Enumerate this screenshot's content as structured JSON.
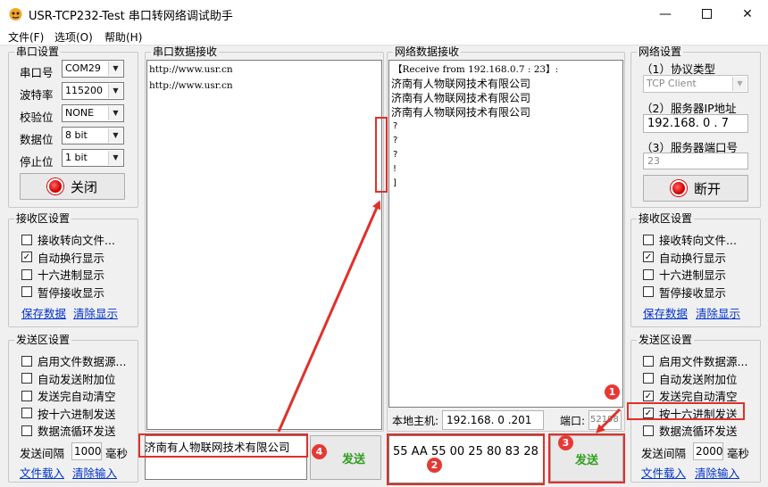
{
  "window": {
    "title": "USR-TCP232-Test 串口转网络调试助手"
  },
  "menu": {
    "file": "文件(F)",
    "options": "选项(O)",
    "help": "帮助(H)"
  },
  "serial_settings": {
    "title": "串口设置",
    "port_label": "串口号",
    "port": "COM29",
    "baud_label": "波特率",
    "baud": "115200",
    "parity_label": "校验位",
    "parity": "NONE",
    "databits_label": "数据位",
    "databits": "8 bit",
    "stopbits_label": "停止位",
    "stopbits": "1 bit",
    "close_button": "关闭"
  },
  "serial_recv_settings": {
    "title": "接收区设置",
    "options": [
      {
        "label": "接收转向文件...",
        "checked": false
      },
      {
        "label": "自动换行显示",
        "checked": true
      },
      {
        "label": "十六进制显示",
        "checked": false
      },
      {
        "label": "暂停接收显示",
        "checked": false
      }
    ],
    "save_link": "保存数据",
    "clear_link": "清除显示"
  },
  "serial_send_settings": {
    "title": "发送区设置",
    "options": [
      {
        "label": "启用文件数据源...",
        "checked": false
      },
      {
        "label": "自动发送附加位",
        "checked": false
      },
      {
        "label": "发送完自动清空",
        "checked": false
      },
      {
        "label": "按十六进制发送",
        "checked": false
      },
      {
        "label": "数据流循环发送",
        "checked": false
      }
    ],
    "interval_label": "发送间隔",
    "interval": "1000",
    "unit": "毫秒",
    "load_link": "文件载入",
    "clear_link": "清除输入"
  },
  "serial_recv": {
    "title": "串口数据接收",
    "lines": [
      "http://www.usr.cn",
      "http://www.usr.cn"
    ]
  },
  "serial_send": {
    "input": "济南有人物联网技术有限公司",
    "send_button": "发送"
  },
  "net_recv": {
    "title": "网络数据接收",
    "header": "【Receive from 192.168.0.7 : 23】:",
    "lines": [
      "济南有人物联网技术有限公司",
      "济南有人物联网技术有限公司",
      "济南有人物联网技术有限公司",
      "?",
      "?",
      "?",
      "!",
      "]"
    ]
  },
  "net_local": {
    "host_label": "本地主机:",
    "host": "192.168. 0 .201",
    "port_label": "端口:",
    "port": "52198"
  },
  "net_send": {
    "input": "55 AA 55 00 25 80 83 28",
    "send_button": "发送"
  },
  "net_settings": {
    "title": "网络设置",
    "proto_label": "（1）协议类型",
    "proto": "TCP Client",
    "ip_label": "（2）服务器IP地址",
    "ip": "192.168. 0 . 7",
    "port_label": "（3）服务器端口号",
    "port": "23",
    "disconnect_button": "断开"
  },
  "net_recv_settings": {
    "title": "接收区设置",
    "options": [
      {
        "label": "接收转向文件...",
        "checked": false
      },
      {
        "label": "自动换行显示",
        "checked": true
      },
      {
        "label": "十六进制显示",
        "checked": false
      },
      {
        "label": "暂停接收显示",
        "checked": false
      }
    ],
    "save_link": "保存数据",
    "clear_link": "清除显示"
  },
  "net_send_settings": {
    "title": "发送区设置",
    "options": [
      {
        "label": "启用文件数据源...",
        "checked": false
      },
      {
        "label": "自动发送附加位",
        "checked": false
      },
      {
        "label": "发送完自动清空",
        "checked": true
      },
      {
        "label": "按十六进制发送",
        "checked": true
      },
      {
        "label": "数据流循环发送",
        "checked": false
      }
    ],
    "interval_label": "发送间隔",
    "interval": "2000",
    "unit": "毫秒",
    "load_link": "文件载入",
    "clear_link": "清除输入"
  },
  "annotations": {
    "b1": "1",
    "b2": "2",
    "b3": "3",
    "b4": "4",
    "color": "#e0302a"
  },
  "icons": {
    "app": "usr-logo-icon",
    "check": "✓"
  }
}
